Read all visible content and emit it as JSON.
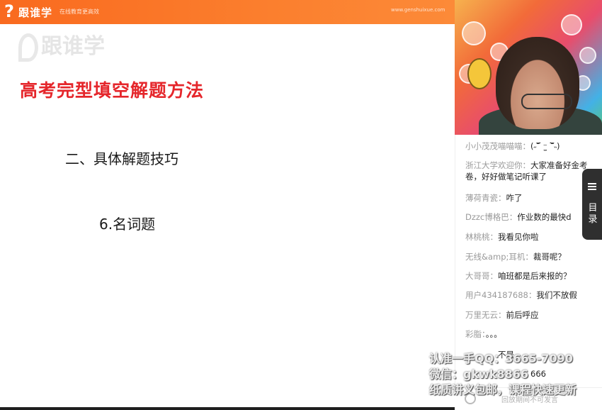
{
  "header": {
    "logo_mark": "?",
    "logo_text": "跟谁学",
    "slogan": "在线教育更高效",
    "url": "www.genshuixue.com"
  },
  "slide": {
    "watermark": "跟谁学",
    "title": "高考完型填空解题方法",
    "section": "二、具体解题技巧",
    "subsection": "6.名词题"
  },
  "chat": {
    "messages": [
      {
        "name": "小小茂茂喵喵喵：",
        "text": "(˶‾᷄ ⁻̫ ‾᷅˵)"
      },
      {
        "name": "浙江大学欢迎你：",
        "text": "大家准备好金考卷，好好做笔记听课了"
      },
      {
        "name": "薄荷青瓷：",
        "text": "咋了"
      },
      {
        "name": "Dzzc博格巴：",
        "text": "作业数的最快d"
      },
      {
        "name": "林桃桃：",
        "text": "我看见你啦"
      },
      {
        "name": "无线&amp;耳机：",
        "text": "裁哥呢？"
      },
      {
        "name": "大哥哥：",
        "text": "咱班都是后来报的？"
      },
      {
        "name": "用户434187688：",
        "text": "我们不放假"
      },
      {
        "name": "万里无云：",
        "text": "前后呼应"
      },
      {
        "name": "彩脂：",
        "text": "。。。"
      },
      {
        "name": "",
        "text": "不是"
      },
      {
        "name": "",
        "text": "666"
      }
    ],
    "footer_muted": "回放期间不可发言"
  },
  "side_menu": {
    "label": "目录"
  },
  "overlay": {
    "line1": "认准一手QQ：3665-7090",
    "line2": "微信：gkwk8866",
    "line3": "纸质讲义包邮，课程快速更新"
  },
  "colors": {
    "brand_orange": "#f96a1f",
    "title_red": "#e5262b"
  }
}
